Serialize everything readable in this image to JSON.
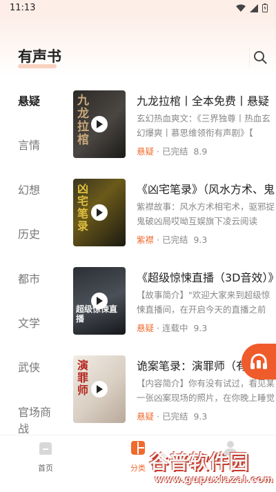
{
  "status": {
    "time": "11:13"
  },
  "header": {
    "title": "有声书"
  },
  "categories": [
    "悬疑",
    "言情",
    "幻想",
    "历史",
    "都市",
    "文学",
    "武侠",
    "官场商战"
  ],
  "active_category_index": 0,
  "books": [
    {
      "title": "九龙拉棺丨全本免费丨悬疑",
      "desc": "玄幻热血爽文：《三界独尊丨热血玄幻爆爽丨慕思维领衔有声剧》【",
      "tag": "悬疑",
      "status": "已完结",
      "score": "8.9",
      "cover_text": "九龙拉棺"
    },
    {
      "title": "《凶宅笔录》（风水方术、鬼",
      "desc": "紫襟故事：风水方术相宅术，驱邪捉鬼破凶局哎呦互娱旗下凌云阅读",
      "tag": "紫襟",
      "status": "已完结",
      "score": "9.3",
      "cover_text": "凶宅笔录"
    },
    {
      "title": "《超级惊悚直播（3D音效）》",
      "desc": "【故事简介】\"欢迎大家来到超级惊悚直播间，在开启今天的直播之前",
      "tag": "悬疑",
      "status": "连载中",
      "score": "9.3",
      "cover_text": "超级惊悚直播"
    },
    {
      "title": "诡案笔录：演罪师（有声剧）",
      "desc": "【内容简介】你有没有试过，看见某一张凶案现场的照片，在你晚上睡觉",
      "tag": "悬疑",
      "status": "已完结",
      "score": "9.3",
      "cover_text": "演罪师"
    }
  ],
  "meta_separator": "·",
  "tabs": [
    {
      "label": "首页"
    },
    {
      "label": "分类"
    },
    {
      "label": ""
    }
  ],
  "active_tab_index": 1,
  "watermark": {
    "title": "谷普软件园",
    "url": "www.gupuxlazal.com"
  },
  "colors": {
    "accent": "#f06a2e",
    "fab": "#f05b2b",
    "header_bg": "#fdeee8"
  },
  "icons": {
    "search": "search-icon",
    "play": "play-icon",
    "fab": "headphones-icon",
    "home": "home-icon",
    "category": "category-icon",
    "profile": "profile-icon"
  }
}
